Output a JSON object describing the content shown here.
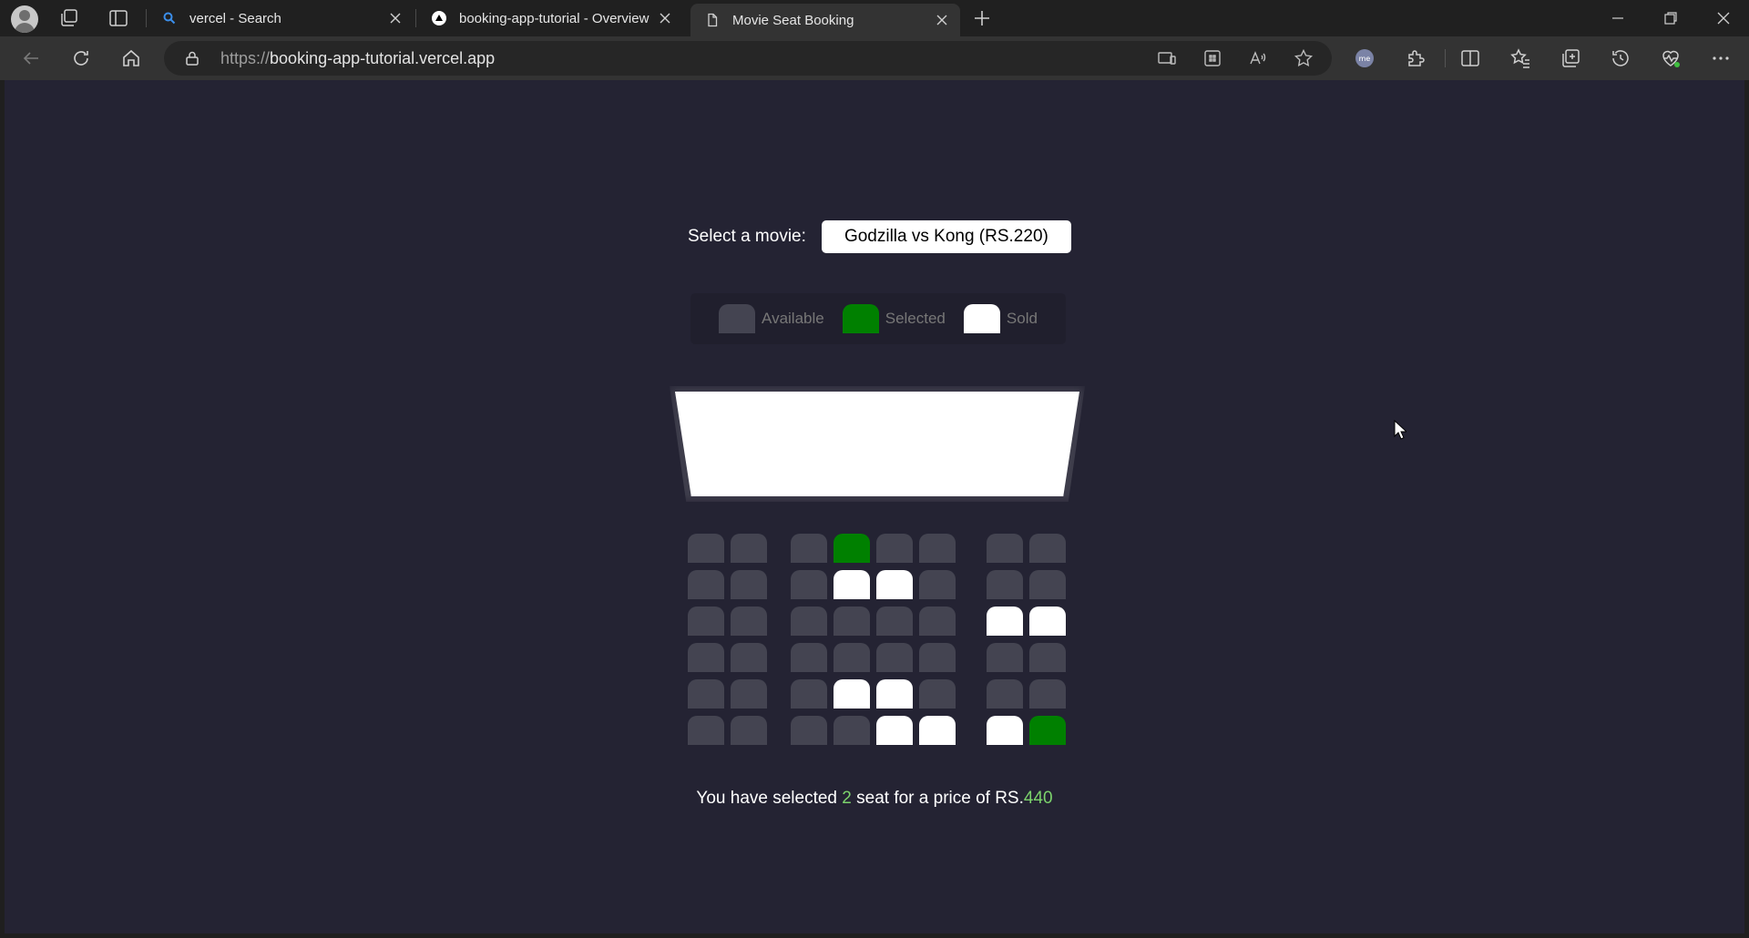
{
  "browser": {
    "tabs": [
      {
        "title": "vercel - Search",
        "icon": "search-icon"
      },
      {
        "title": "booking-app-tutorial - Overview",
        "icon": "vercel-triangle-icon"
      },
      {
        "title": "Movie Seat Booking",
        "icon": "document-icon",
        "active": true
      }
    ],
    "url": {
      "protocol": "https://",
      "host": "booking-app-tutorial.vercel.app"
    }
  },
  "page": {
    "movie_label": "Select a movie:",
    "selected_movie": "Godzilla vs Kong (RS.220)",
    "legend": [
      {
        "label": "Available",
        "color": "#444451"
      },
      {
        "label": "Selected",
        "color": "#008000"
      },
      {
        "label": "Sold",
        "color": "#ffffff"
      }
    ],
    "seat_rows": [
      [
        "available",
        "available",
        "available",
        "selected",
        "available",
        "available",
        "available",
        "available"
      ],
      [
        "available",
        "available",
        "available",
        "sold",
        "sold",
        "available",
        "available",
        "available"
      ],
      [
        "available",
        "available",
        "available",
        "available",
        "available",
        "available",
        "sold",
        "sold"
      ],
      [
        "available",
        "available",
        "available",
        "available",
        "available",
        "available",
        "available",
        "available"
      ],
      [
        "available",
        "available",
        "available",
        "sold",
        "sold",
        "available",
        "available",
        "available"
      ],
      [
        "available",
        "available",
        "available",
        "available",
        "sold",
        "sold",
        "sold",
        "selected"
      ]
    ],
    "summary": {
      "prefix": "You have selected ",
      "count": "2",
      "middle": " seat for a price of RS.",
      "total": "440"
    }
  },
  "colors": {
    "background": "#242333",
    "selected": "#008000",
    "sold": "#ffffff",
    "available": "#444451"
  }
}
